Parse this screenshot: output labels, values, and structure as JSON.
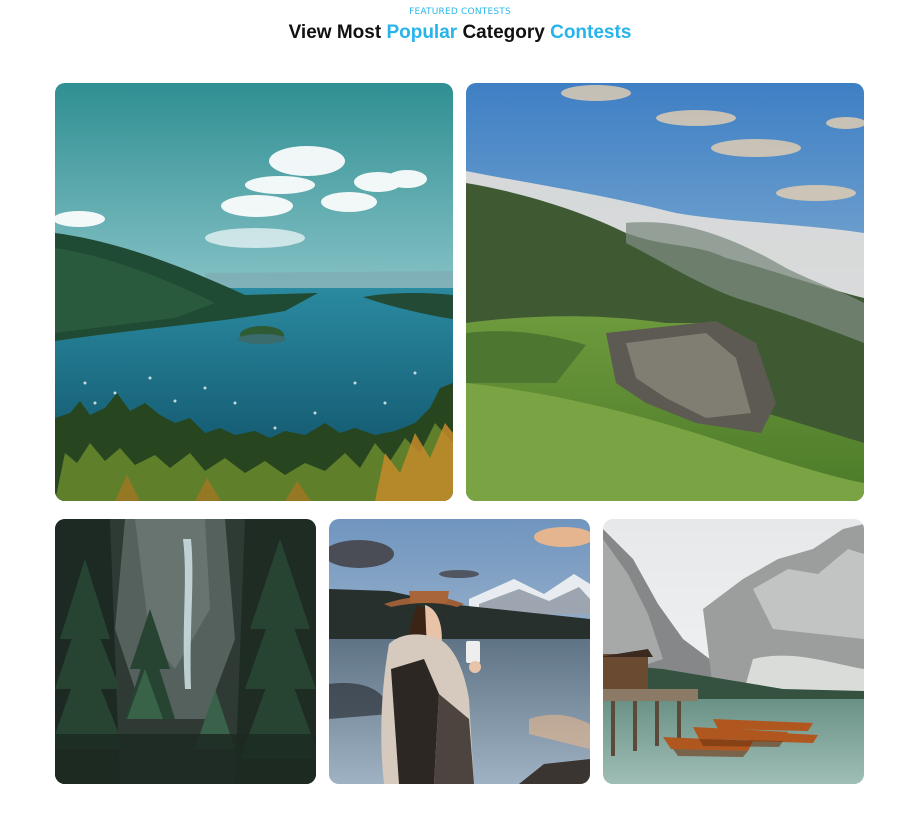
{
  "header": {
    "eyebrow": "FEATURED CONTESTS",
    "title_part1": "View Most ",
    "title_accent1": "Popular",
    "title_part2": " Category ",
    "title_accent2": "Contests"
  },
  "colors": {
    "accent": "#27b4ea",
    "heading": "#111111",
    "background": "#ffffff"
  },
  "gallery": {
    "tiles": [
      {
        "name": "lake-island-photo"
      },
      {
        "name": "green-cliff-photo"
      },
      {
        "name": "forest-waterfall-photo"
      },
      {
        "name": "woman-lake-photo"
      },
      {
        "name": "mountain-lake-boats-photo"
      }
    ]
  }
}
